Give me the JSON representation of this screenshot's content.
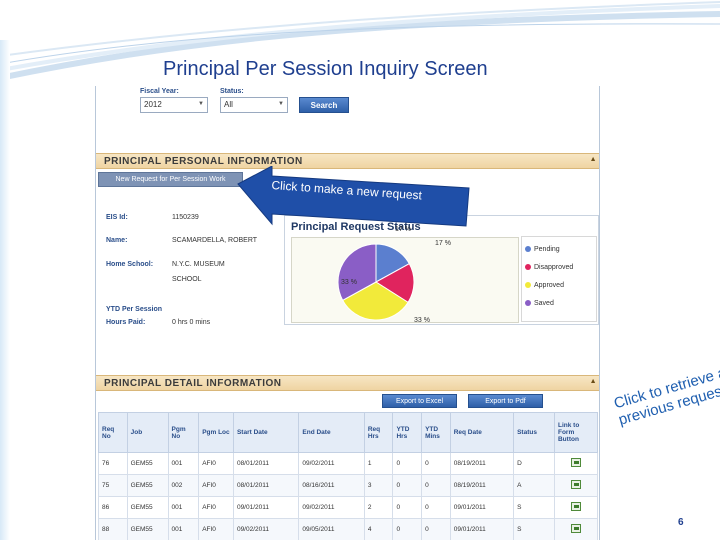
{
  "slide": {
    "title": "Principal Per Session Inquiry Screen",
    "page_number": "6",
    "callout_text": "Click to make a new request",
    "side_note_lines": [
      "Click to retrieve a",
      "previous request"
    ]
  },
  "filters": {
    "fiscal_year_label": "Fiscal Year:",
    "fiscal_year_value": "2012",
    "status_label": "Status:",
    "status_value": "All",
    "search_label": "Search"
  },
  "personal": {
    "header": "PRINCIPAL PERSONAL INFORMATION",
    "new_request_label": "New Request for Per Session Work",
    "eis_label": "EIS Id:",
    "eis_value": "1150239",
    "name_label": "Name:",
    "name_value": "SCAMARDELLA, ROBERT",
    "school_label": "Home School:",
    "school_value_1": "N.Y.C. MUSEUM",
    "school_value_2": "SCHOOL",
    "ytd_label_1": "YTD Per Session",
    "ytd_label_2": "Hours Paid:",
    "ytd_value": "0 hrs 0 mins"
  },
  "chart_data": {
    "type": "pie",
    "title": "Principal Request Status",
    "slices": [
      {
        "label": "Pending",
        "value": 17,
        "color": "#5b7fcf"
      },
      {
        "label": "Disapproved",
        "value": 17,
        "color": "#e0245e"
      },
      {
        "label": "Approved",
        "value": 33,
        "color": "#f2ea3a"
      },
      {
        "label": "Saved",
        "value": 33,
        "color": "#8a5ec6"
      }
    ],
    "data_labels": [
      "17 %",
      "17 %",
      "33 %",
      "33 %"
    ],
    "legend": [
      "Pending",
      "Disapproved",
      "Approved",
      "Saved"
    ]
  },
  "detail": {
    "header": "PRINCIPAL DETAIL INFORMATION",
    "export_excel": "Export to Excel",
    "export_pdf": "Export to Pdf",
    "columns": [
      "Req No",
      "Job",
      "Pgm No",
      "Pgm Loc",
      "Start Date",
      "End Date",
      "Req Hrs",
      "YTD Hrs",
      "YTD Mins",
      "Req Date",
      "Status",
      "Link to Form Button"
    ],
    "rows": [
      [
        "76",
        "GEM55",
        "001",
        "AFI0",
        "08/01/2011",
        "09/02/2011",
        "1",
        "0",
        "0",
        "08/19/2011",
        "D"
      ],
      [
        "75",
        "GEM55",
        "002",
        "AFI0",
        "08/01/2011",
        "08/16/2011",
        "3",
        "0",
        "0",
        "08/19/2011",
        "A"
      ],
      [
        "86",
        "GEM55",
        "001",
        "AFI0",
        "09/01/2011",
        "09/02/2011",
        "2",
        "0",
        "0",
        "09/01/2011",
        "S"
      ],
      [
        "88",
        "GEM55",
        "001",
        "AFI0",
        "09/02/2011",
        "09/05/2011",
        "4",
        "0",
        "0",
        "09/01/2011",
        "S"
      ]
    ]
  }
}
